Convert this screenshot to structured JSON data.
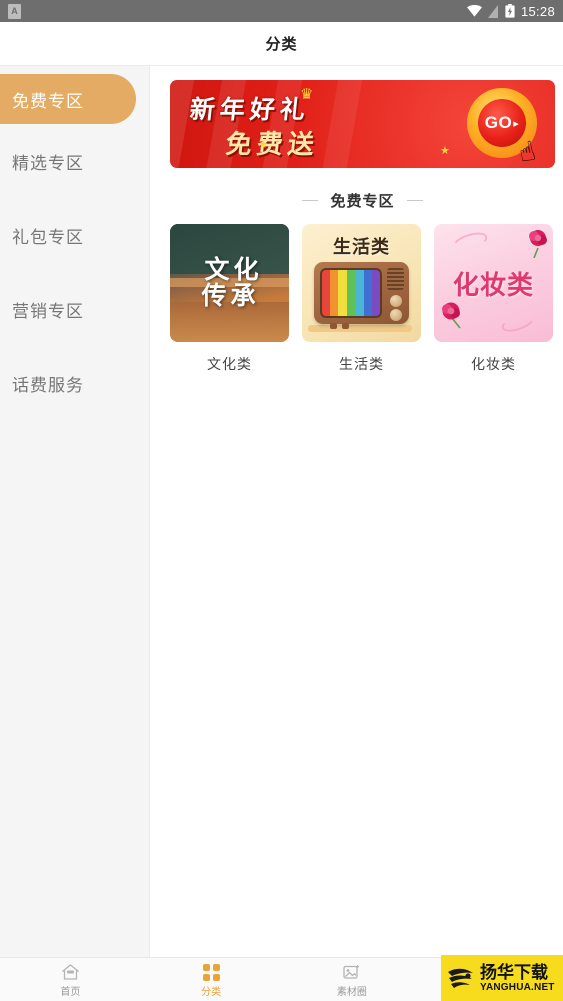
{
  "status_bar": {
    "app_icon_letter": "A",
    "icons": [
      "wifi-icon",
      "signal-icon",
      "battery-charging-icon"
    ],
    "time": "15:28"
  },
  "header": {
    "title": "分类"
  },
  "sidebar": {
    "items": [
      {
        "label": "免费专区",
        "active": true
      },
      {
        "label": "精选专区",
        "active": false
      },
      {
        "label": "礼包专区",
        "active": false
      },
      {
        "label": "营销专区",
        "active": false
      },
      {
        "label": "话费服务",
        "active": false
      }
    ],
    "active_color": "#e3ab63"
  },
  "banner": {
    "line1": "新年好礼",
    "line2": "免费送",
    "button_label": "GO",
    "button_arrow": "▸",
    "background_color": "#e8201c",
    "button_color": "#e8211a"
  },
  "section": {
    "title": "免费专区",
    "left_dash": "",
    "right_dash": ""
  },
  "cards": [
    {
      "label": "文化类",
      "thumb_text_line1": "文化",
      "thumb_text_line2": "传承",
      "thumb_style": "culture"
    },
    {
      "label": "生活类",
      "thumb_text_line1": "生活类",
      "thumb_text_line2": "",
      "thumb_style": "life-tv"
    },
    {
      "label": "化妆类",
      "thumb_text_line1": "化妆类",
      "thumb_text_line2": "",
      "thumb_style": "cosmetics"
    }
  ],
  "tabbar": {
    "items": [
      {
        "label": "首页",
        "icon": "home-icon",
        "active": false
      },
      {
        "label": "分类",
        "icon": "grid-icon",
        "active": true
      },
      {
        "label": "素材圈",
        "icon": "image-icon",
        "active": false
      }
    ],
    "active_color": "#e8a33a"
  },
  "watermark": {
    "cn": "扬华下载",
    "en": "YANGHUA.NET",
    "background_color": "#f7dc1e"
  }
}
